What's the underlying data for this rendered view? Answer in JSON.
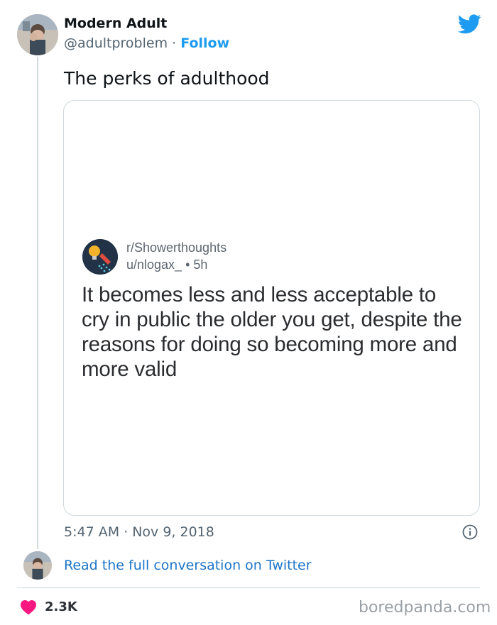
{
  "tweet": {
    "author_name": "Modern Adult",
    "handle": "@adultproblem",
    "separator": "·",
    "follow_label": "Follow",
    "text": "The perks of adulthood",
    "timestamp": "5:47 AM · Nov 9, 2018",
    "read_full_label": "Read the full conversation on Twitter",
    "likes": "2.3K"
  },
  "embedded_post": {
    "subreddit": "r/Showerthoughts",
    "user_line": "u/nlogax_ • 5h",
    "text": "It becomes less and less acceptable to cry in public the older you get, despite the reasons for doing so becoming more and more valid"
  },
  "watermark": "boredpanda.com",
  "icons": {
    "brand": "twitter-bird-icon",
    "info": "info-icon",
    "like": "heart-icon",
    "subreddit": "showerthoughts-logo"
  },
  "colors": {
    "link": "#1d9bf0",
    "heart": "#f91880",
    "subreddit_logo_bg": "#223347",
    "text_secondary": "#536471",
    "border": "#cfd9de"
  }
}
